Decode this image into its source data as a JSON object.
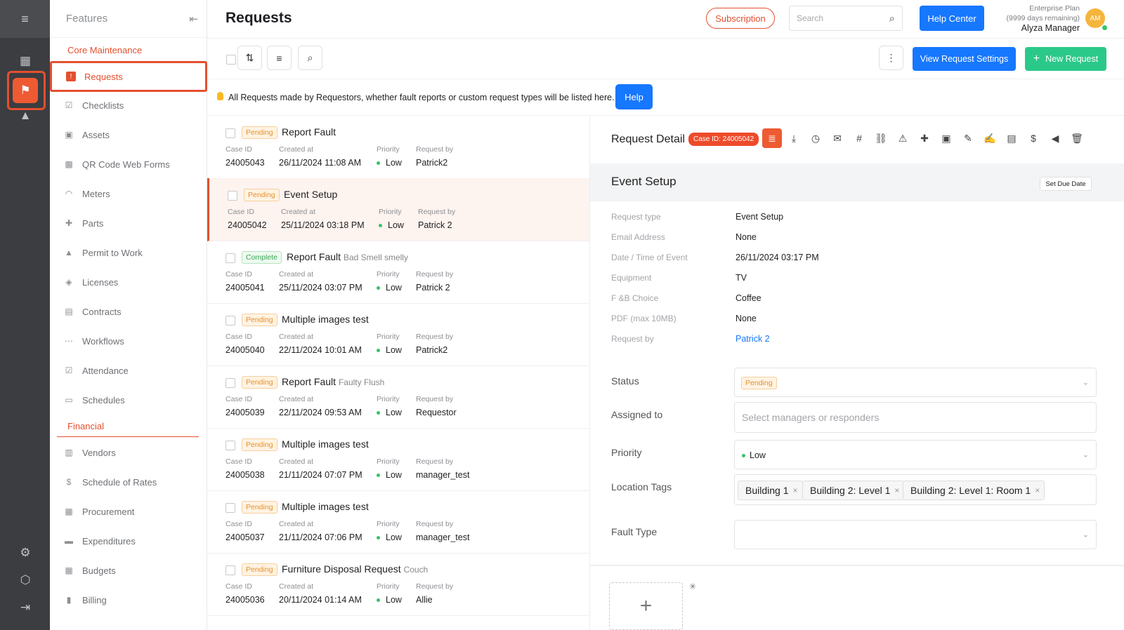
{
  "rail": {
    "top_icon": "≡",
    "dashboard_icon": "▦",
    "active_icon": "⚑",
    "stats_icon": "▲",
    "settings_icon": "⚙",
    "box_icon": "⬡",
    "exit_icon": "⇥"
  },
  "sidebar": {
    "header": "Features",
    "collapse_icon": "⇤",
    "sections": [
      {
        "label": "Core Maintenance"
      },
      {
        "label": "Financial"
      }
    ],
    "items": [
      {
        "label": "Requests",
        "icon": "!"
      },
      {
        "label": "Checklists",
        "icon": "☑"
      },
      {
        "label": "Assets",
        "icon": "▣"
      },
      {
        "label": "QR Code Web Forms",
        "icon": "▩"
      },
      {
        "label": "Meters",
        "icon": "◠"
      },
      {
        "label": "Parts",
        "icon": "✚"
      },
      {
        "label": "Permit to Work",
        "icon": "▲"
      },
      {
        "label": "Licenses",
        "icon": "◈"
      },
      {
        "label": "Contracts",
        "icon": "▤"
      },
      {
        "label": "Workflows",
        "icon": "⋯"
      },
      {
        "label": "Attendance",
        "icon": "☑"
      },
      {
        "label": "Schedules",
        "icon": "▭"
      },
      {
        "label": "Vendors",
        "icon": "▥"
      },
      {
        "label": "Schedule of Rates",
        "icon": "$"
      },
      {
        "label": "Procurement",
        "icon": "▦"
      },
      {
        "label": "Expenditures",
        "icon": "▬"
      },
      {
        "label": "Budgets",
        "icon": "▦"
      },
      {
        "label": "Billing",
        "icon": "▮"
      }
    ]
  },
  "header": {
    "title": "Requests",
    "subscription": "Subscription",
    "search_placeholder": "Search",
    "help_center": "Help Center",
    "plan": "Enterprise Plan",
    "days": "(9999 days remaining)",
    "user": "Alyza Manager",
    "avatar": "AM"
  },
  "toolbar": {
    "view_settings": "View Request Settings",
    "new_request": "New Request",
    "new_icon": "+",
    "sort_icon": "⇅",
    "filter_icon": "≡",
    "search_icon": "⌕",
    "more_icon": "⋮"
  },
  "info": {
    "text": "All Requests made by Requestors, whether fault reports or custom request types will be listed here.",
    "help": "Help"
  },
  "labels": {
    "case_id": "Case ID",
    "created_at": "Created at",
    "priority": "Priority",
    "request_by": "Request by"
  },
  "requests": [
    {
      "status": "Pending",
      "title": "Report Fault",
      "sub": "",
      "case_id": "24005043",
      "created": "26/11/2024 11:08 AM",
      "priority": "Low",
      "by": "Patrick2"
    },
    {
      "status": "Pending",
      "title": "Event Setup",
      "sub": "",
      "case_id": "24005042",
      "created": "25/11/2024 03:18 PM",
      "priority": "Low",
      "by": "Patrick 2"
    },
    {
      "status": "Complete",
      "title": "Report Fault",
      "sub": "Bad Smell smelly",
      "case_id": "24005041",
      "created": "25/11/2024 03:07 PM",
      "priority": "Low",
      "by": "Patrick 2"
    },
    {
      "status": "Pending",
      "title": "Multiple images test",
      "sub": "",
      "case_id": "24005040",
      "created": "22/11/2024 10:01 AM",
      "priority": "Low",
      "by": "Patrick2"
    },
    {
      "status": "Pending",
      "title": "Report Fault",
      "sub": "Faulty Flush",
      "case_id": "24005039",
      "created": "22/11/2024 09:53 AM",
      "priority": "Low",
      "by": "Requestor"
    },
    {
      "status": "Pending",
      "title": "Multiple images test",
      "sub": "",
      "case_id": "24005038",
      "created": "21/11/2024 07:07 PM",
      "priority": "Low",
      "by": "manager_test"
    },
    {
      "status": "Pending",
      "title": "Multiple images test",
      "sub": "",
      "case_id": "24005037",
      "created": "21/11/2024 07:06 PM",
      "priority": "Low",
      "by": "manager_test"
    },
    {
      "status": "Pending",
      "title": "Furniture Disposal Request",
      "sub": "Couch",
      "case_id": "24005036",
      "created": "20/11/2024 01:14 AM",
      "priority": "Low",
      "by": "Allie"
    }
  ],
  "detail": {
    "title": "Request Detail",
    "case_badge": "Case ID: 24005042",
    "icons": [
      "≣",
      "⤓",
      "◷",
      "✉",
      "#",
      "⛓",
      "⚠",
      "✚",
      "▣",
      "✎",
      "✍",
      "▤",
      "$",
      "◀",
      "🗑"
    ],
    "event_title": "Event Setup",
    "due_button": "Set Due Date",
    "fields": [
      {
        "label": "Request type",
        "value": "Event Setup"
      },
      {
        "label": "Email Address",
        "value": "None"
      },
      {
        "label": "Date / Time of Event",
        "value": "26/11/2024 03:17 PM"
      },
      {
        "label": "Equipment",
        "value": "TV"
      },
      {
        "label": "F &B Choice",
        "value": "Coffee"
      },
      {
        "label": "PDF (max 10MB)",
        "value": "None"
      },
      {
        "label": "Request by",
        "value": "Patrick 2"
      }
    ],
    "status_label": "Status",
    "status_value": "Pending",
    "assigned_label": "Assigned to",
    "assigned_placeholder": "Select managers or responders",
    "priority_label": "Priority",
    "priority_value": "Low",
    "location_label": "Location Tags",
    "location_tags": [
      "Building 1",
      "Building 2: Level 1",
      "Building 2: Level 1: Room 1"
    ],
    "fault_label": "Fault Type",
    "upload_icon": "+",
    "asterisk": "✳"
  },
  "colors": {
    "accent": "#e4502f",
    "primary": "#1677ff",
    "success": "#2ac989"
  }
}
